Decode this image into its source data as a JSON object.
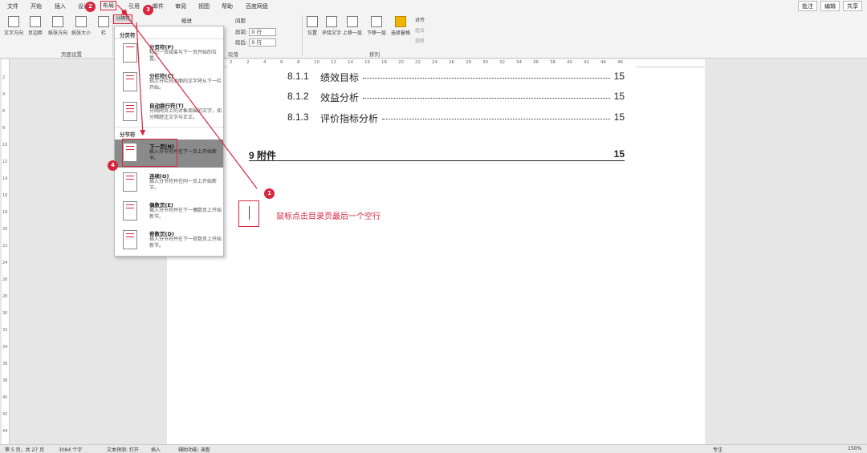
{
  "ribbon": {
    "tabs": [
      "文件",
      "开始",
      "插入",
      "设计",
      "布局",
      "引用",
      "邮件",
      "审阅",
      "视图",
      "帮助",
      "百度网盘"
    ],
    "active_tab": "布局",
    "top_right": {
      "comment": "批注",
      "edit": "编辑",
      "share": "共享"
    },
    "page_setup": {
      "text_direction": "文字方向",
      "margins": "页边距",
      "orientation": "纸张方向",
      "size": "纸张大小",
      "columns": "栏",
      "breaks": "分隔符",
      "group_label": "页面设置"
    },
    "indent_label": "缩进",
    "spacing_label": "间距",
    "spacing_before_label": "段前:",
    "spacing_before_value": "0 行",
    "spacing_after_label": "段后:",
    "spacing_after_value": "0 行",
    "paragraph_group": "段落",
    "arrange": {
      "position": "位置",
      "wrap_text": "环绕文字",
      "bring_forward": "上移一层",
      "send_backward": "下移一层",
      "selection_pane": "选择窗格",
      "align": "对齐",
      "group": "组合",
      "rotate": "旋转",
      "group_label": "排列"
    }
  },
  "ruler_numbers": [
    "2",
    "2",
    "4",
    "6",
    "8",
    "10",
    "12",
    "14",
    "16",
    "18",
    "20",
    "22",
    "24",
    "26",
    "28",
    "30",
    "32",
    "34",
    "36",
    "38",
    "40",
    "42",
    "44",
    "46"
  ],
  "vruler_numbers": [
    "2",
    "4",
    "6",
    "8",
    "10",
    "12",
    "14",
    "16",
    "18",
    "20",
    "22",
    "24",
    "26",
    "28",
    "30",
    "32",
    "34",
    "36",
    "38",
    "40",
    "42",
    "44"
  ],
  "document": {
    "toc": [
      {
        "num": "8.1.1",
        "text": "绩效目标",
        "page": "15"
      },
      {
        "num": "8.1.2",
        "text": "效益分析",
        "page": "15"
      },
      {
        "num": "8.1.3",
        "text": "评价指标分析",
        "page": "15"
      }
    ],
    "toc_main": {
      "text": "9  附件",
      "page": "15"
    },
    "annotation": "鼠标点击目录页最后一个空行"
  },
  "badges": [
    "1",
    "2",
    "3",
    "4"
  ],
  "breaks_menu": {
    "page_breaks_header": "分页符",
    "section_breaks_header": "分节符",
    "items": [
      {
        "title": "分页符(P)",
        "desc": "标记一页结束与下一页开始的位置。"
      },
      {
        "title": "分栏符(C)",
        "desc": "指示分栏符后面的文字将从下一栏开始。"
      },
      {
        "title": "自动换行符(T)",
        "desc": "分隔网页上的对象周围的文字，如分隔题注文字与正文。"
      },
      {
        "title": "下一页(N)",
        "desc": "插入分节符并在下一页上开始新节。"
      },
      {
        "title": "连续(O)",
        "desc": "插入分节符并在同一页上开始新节。"
      },
      {
        "title": "偶数页(E)",
        "desc": "插入分节符并在下一偶数页上开始新节。"
      },
      {
        "title": "奇数页(D)",
        "desc": "插入分节符并在下一奇数页上开始新节。"
      }
    ]
  },
  "status": {
    "page": "第 5 页，共 27 页",
    "words": "3084 个字",
    "predict": "文本预测: 打开",
    "insert": "插入",
    "accessibility": "辅助功能: 调查",
    "focus": "专注",
    "zoom": "150%"
  },
  "colors": {
    "accent": "#d7263d",
    "ribbon_bg": "#f3f3f3",
    "workspace": "#e6e6e6"
  }
}
